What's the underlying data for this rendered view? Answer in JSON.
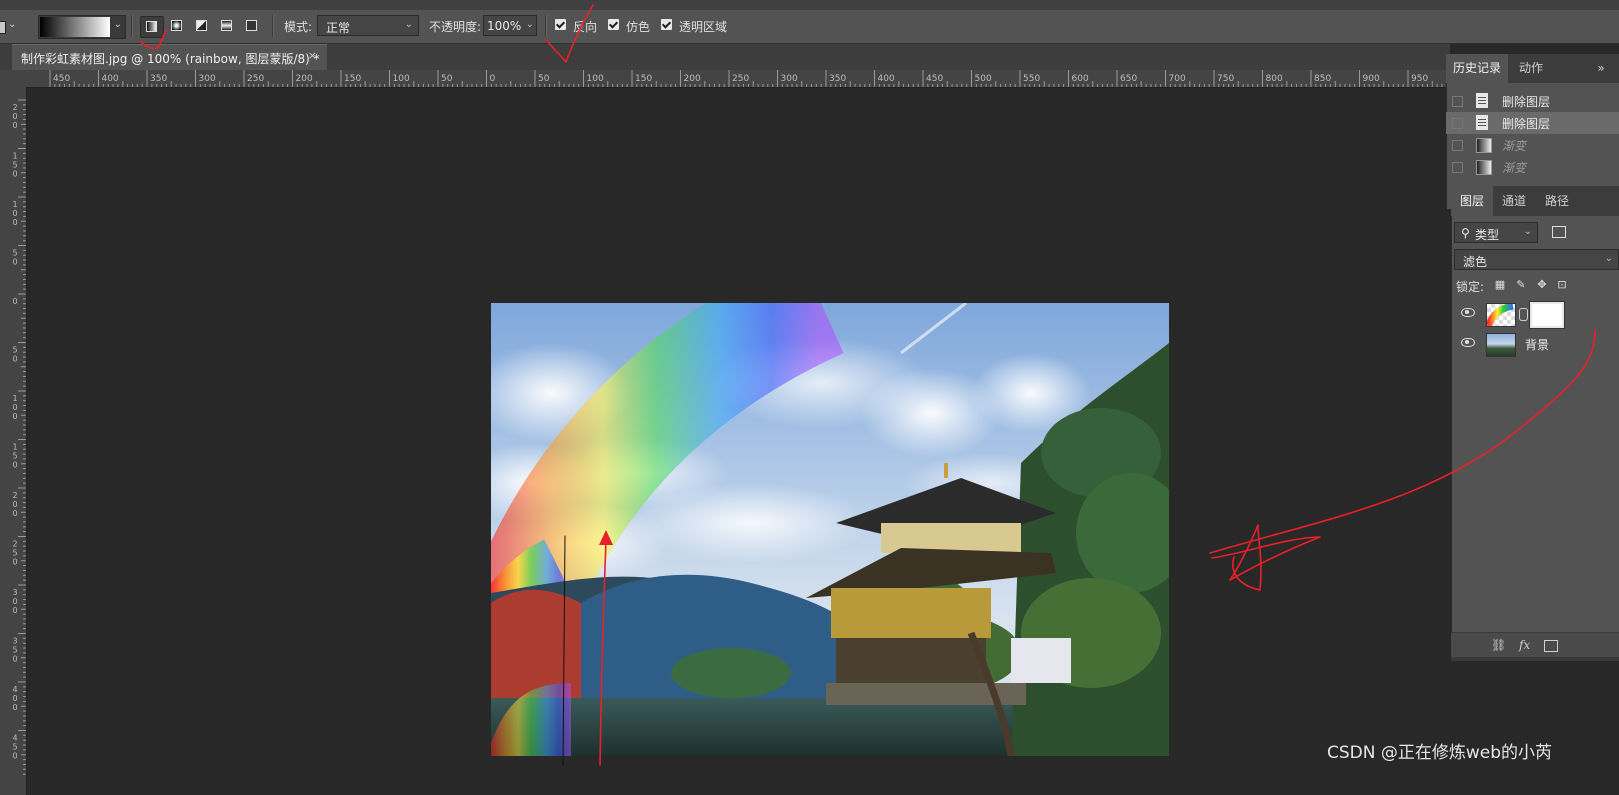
{
  "options_bar": {
    "gradient_preview": "black-to-white",
    "mode_label": "模式:",
    "mode_value": "正常",
    "opacity_label": "不透明度:",
    "opacity_value": "100%",
    "reverse_label": "反向",
    "dither_label": "仿色",
    "transparency_label": "透明区域",
    "gradient_types": [
      "linear-gradient-icon",
      "radial-gradient-icon",
      "angle-gradient-icon",
      "reflected-gradient-icon",
      "diamond-gradient-icon"
    ],
    "checkbox_reverse": true,
    "checkbox_dither": true,
    "checkbox_transparency": true
  },
  "document_tab": {
    "title": "制作彩虹素材图.jpg @ 100% (rainbow, 图层蒙版/8) *",
    "close": "×"
  },
  "ruler_h_labels": [
    "450",
    "400",
    "350",
    "300",
    "250",
    "200",
    "150",
    "100",
    "50",
    "0",
    "50",
    "100",
    "150",
    "200",
    "250",
    "300",
    "350",
    "400",
    "450",
    "500",
    "550",
    "600",
    "650",
    "700",
    "750",
    "800",
    "850",
    "900",
    "950"
  ],
  "ruler_v_labels": [
    "2 0 0",
    "1 5 0",
    "1 0 0",
    "5 0",
    "0",
    "5 0",
    "1 0 0",
    "1 5 0",
    "2 0 0",
    "2 5 0",
    "3 0 0",
    "3 5 0",
    "4 0 0",
    "4 5 0"
  ],
  "history_panel": {
    "tabs": [
      "历史记录",
      "动作"
    ],
    "items": [
      {
        "label": "删除图层",
        "icon": "document-icon",
        "selected": false,
        "dim": false
      },
      {
        "label": "删除图层",
        "icon": "document-icon",
        "selected": true,
        "dim": false
      },
      {
        "label": "渐变",
        "icon": "gradient-icon",
        "selected": false,
        "dim": true
      },
      {
        "label": "渐变",
        "icon": "gradient-icon",
        "selected": false,
        "dim": true
      }
    ]
  },
  "layers_panel": {
    "tabs": [
      "图层",
      "通道",
      "路径"
    ],
    "filter_kind": "类型",
    "blend_mode": "滤色",
    "lock_label": "锁定:",
    "layers": [
      {
        "name": "",
        "thumb": "rainbow",
        "has_mask": true,
        "visible": true
      },
      {
        "name": "背景",
        "thumb": "photo",
        "has_mask": false,
        "visible": true
      }
    ],
    "footer_icons": [
      "link-icon",
      "fx-icon",
      "mask-icon"
    ],
    "fx_text": "fx"
  },
  "watermark": "CSDN @正在修炼web的小芮",
  "colors": {
    "annotation_red": "#e8202a",
    "panel_bg": "#535353",
    "canvas_bg": "#282828"
  }
}
